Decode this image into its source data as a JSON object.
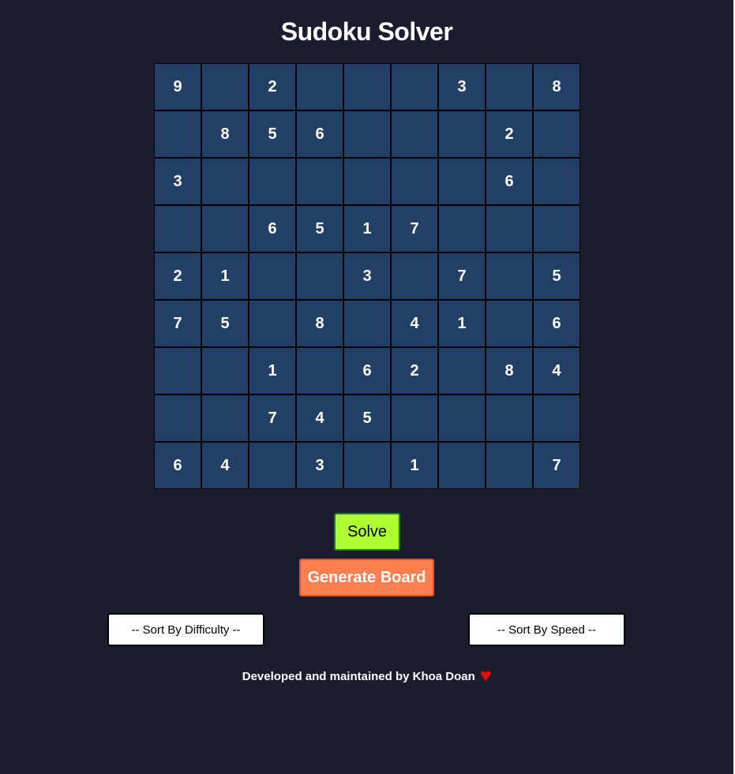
{
  "page": {
    "title": "Sudoku Solver"
  },
  "board": {
    "rows": [
      [
        "9",
        "",
        "2",
        "",
        "",
        "",
        "3",
        "",
        "8"
      ],
      [
        "",
        "8",
        "5",
        "6",
        "",
        "",
        "",
        "2",
        ""
      ],
      [
        "3",
        "",
        "",
        "",
        "",
        "",
        "",
        "6",
        ""
      ],
      [
        "",
        "",
        "6",
        "5",
        "1",
        "7",
        "",
        "",
        ""
      ],
      [
        "2",
        "1",
        "",
        "",
        "3",
        "",
        "7",
        "",
        "5"
      ],
      [
        "7",
        "5",
        "",
        "8",
        "",
        "4",
        "1",
        "",
        "6"
      ],
      [
        "",
        "",
        "1",
        "",
        "6",
        "2",
        "",
        "8",
        "4"
      ],
      [
        "",
        "",
        "7",
        "4",
        "5",
        "",
        "",
        "",
        ""
      ],
      [
        "6",
        "4",
        "",
        "3",
        "",
        "1",
        "",
        "",
        "7"
      ]
    ]
  },
  "controls": {
    "solve_label": "Solve",
    "generate_label": "Generate Board",
    "sort_difficulty": {
      "selected": "-- Sort By Difficulty --"
    },
    "sort_speed": {
      "selected": "-- Sort By Speed --"
    }
  },
  "footer": {
    "text": "Developed and maintained by Khoa Doan",
    "heart_icon": "heart-icon",
    "heart_glyph": "♥"
  },
  "colors": {
    "background": "#1b1c30",
    "cell": "#224066",
    "solve": "#adff2f",
    "generate": "#ff7f50",
    "heart": "#ff0000"
  }
}
